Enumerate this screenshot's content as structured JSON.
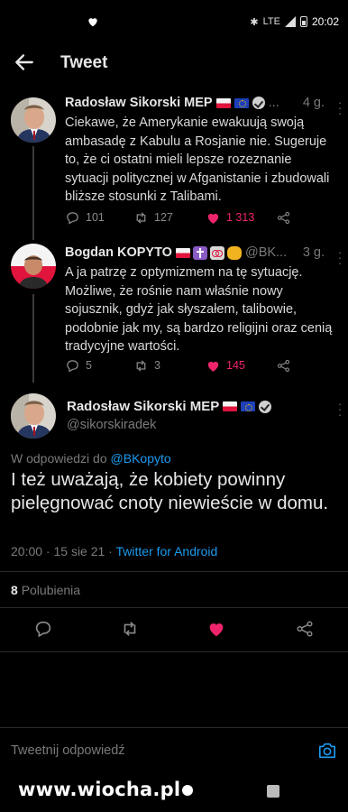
{
  "status_bar": {
    "time": "20:02",
    "network": "LTE",
    "icons": [
      "heart-icon",
      "bluetooth-icon",
      "signal-icon",
      "battery-icon"
    ]
  },
  "header": {
    "title": "Tweet"
  },
  "tweets": [
    {
      "name": "Radosław Sikorski MEP",
      "handle": "...",
      "time": "4 g.",
      "text": "Ciekawe, że Amerykanie ewakuują swoją ambasadę z Kabulu a Rosjanie nie. Sugeruje to, że ci ostatni mieli lepsze rozeznanie sytuacji politycznej w Afganistanie i zbudowali bliższe stosunki z Talibami.",
      "replies": "101",
      "retweets": "127",
      "likes": "1 313"
    },
    {
      "name": "Bogdan KOPYTO",
      "handle": "@BK...",
      "time": "3 g.",
      "text": "A ja patrzę z optymizmem na tę sytuację. Możliwe, że rośnie nam właśnie nowy sojusznik, gdyż jak słyszałem, talibowie, podobnie jak my, są bardzo religijni oraz cenią tradycyjne wartości.",
      "replies": "5",
      "retweets": "3",
      "likes": "145"
    }
  ],
  "main": {
    "name": "Radosław Sikorski MEP",
    "handle": "@sikorskiradek",
    "reply_prefix": "W odpowiedzi do",
    "reply_to": "@BKopyto",
    "text": "I też uważają, że kobiety powinny pielęgnować cnoty niewieście w domu.",
    "timestamp": "20:00 · 15 sie 21 ·",
    "source": "Twitter for Android",
    "likes_count": "8",
    "likes_label": "Polubienia"
  },
  "reply_box": {
    "placeholder": "Tweetnij odpowiedź"
  },
  "watermark": "www.wiocha.pl",
  "colors": {
    "background": "#000000",
    "link": "#1d9bf0",
    "like": "#f0246d",
    "secondary_text": "#7a7a7a"
  }
}
